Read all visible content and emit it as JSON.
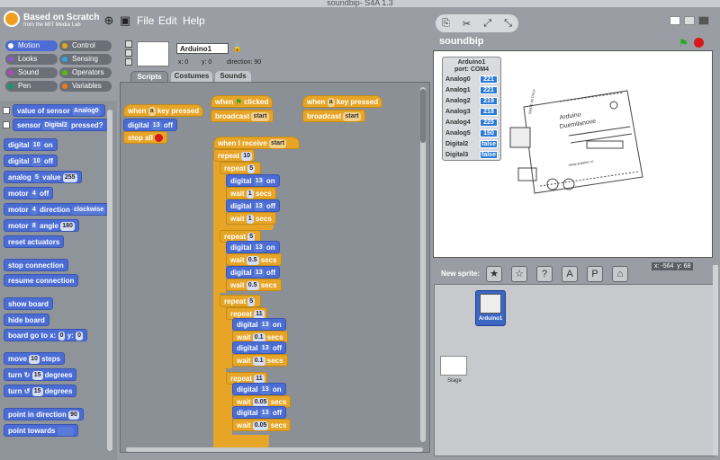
{
  "window": {
    "title": "soundbip- S4A 1.3"
  },
  "header": {
    "logo_line1": "Based on Scratch",
    "logo_line2": "from the MIT Media Lab"
  },
  "menu": {
    "file": "File",
    "edit": "Edit",
    "help": "Help"
  },
  "categories": {
    "motion": "Motion",
    "looks": "Looks",
    "sound": "Sound",
    "pen": "Pen",
    "control": "Control",
    "sensing": "Sensing",
    "operators": "Operators",
    "variables": "Variables",
    "colors": {
      "motion": "#4a6cd4",
      "looks": "#8a55d7",
      "sound": "#bb42c3",
      "pen": "#0e9a6c",
      "control": "#e1a91a",
      "sensing": "#2ca5e2",
      "operators": "#5cb712",
      "variables": "#ee7d16"
    }
  },
  "palette": {
    "value_of_sensor": "value of sensor",
    "sensor_opt": "Analog0",
    "sensor": "sensor",
    "sensor_opt2": "Digital2",
    "pressed": "pressed?",
    "digital": "digital",
    "on": "on",
    "off": "off",
    "pin13": "13",
    "pin10": "10",
    "analog": "analog",
    "analog_pin": "5",
    "value": "value",
    "value_num": "255",
    "motor": "motor",
    "motor_pin": "4",
    "direction": "direction",
    "clockwise": "clockwise",
    "motor_pin2": "8",
    "angle": "angle",
    "angle_num": "180",
    "reset_actuators": "reset actuators",
    "stop_connection": "stop connection",
    "resume_connection": "resume connection",
    "show_board": "show board",
    "hide_board": "hide board",
    "board_go_to": "board go to x:",
    "zero": "0",
    "y": "y:",
    "move": "move",
    "ten": "10",
    "steps": "steps",
    "turn": "turn",
    "fifteen": "15",
    "degrees": "degrees",
    "point_in_direction": "point in direction",
    "ninety": "90",
    "point_towards": "point towards"
  },
  "sprite": {
    "name": "Arduino1",
    "x_label": "x:",
    "x": "0",
    "y_label": "y:",
    "y": "0",
    "dir_label": "direction:",
    "dir": "90"
  },
  "tabs": {
    "scripts": "Scripts",
    "costumes": "Costumes",
    "sounds": "Sounds"
  },
  "scripts": {
    "when": "when",
    "key_pressed": "key pressed",
    "key": "a",
    "clicked": "clicked",
    "stop_all": "stop all",
    "broadcast": "broadcast",
    "start": "start",
    "when_i_receive": "when I receive",
    "repeat": "repeat",
    "r10": "10",
    "r5": "5",
    "r11": "11",
    "wait": "wait",
    "secs": "secs",
    "w1": "1",
    "w05": "0.5",
    "w01": "0.1",
    "w005": "0.05"
  },
  "stage": {
    "title": "soundbip"
  },
  "monitor": {
    "title": "Arduino1",
    "port": "port: COM4",
    "rows": [
      {
        "label": "Analog0",
        "value": "221"
      },
      {
        "label": "Analog1",
        "value": "221"
      },
      {
        "label": "Analog2",
        "value": "219"
      },
      {
        "label": "Analog3",
        "value": "218"
      },
      {
        "label": "Analog4",
        "value": "225"
      },
      {
        "label": "Analog5",
        "value": "150"
      },
      {
        "label": "Digital2",
        "value": "false"
      },
      {
        "label": "Digital3",
        "value": "false"
      }
    ]
  },
  "board_labels": {
    "made_in": "MADE IN ITALY",
    "arduino": "Arduino",
    "duemilanove": "Duemilanove",
    "url": "www.arduino.cc"
  },
  "sprites_panel": {
    "new_sprite": "New sprite:",
    "mouse_x": "x: -564",
    "mouse_y": "y: 68",
    "stage_label": "Stage",
    "sprite1": "Arduino1"
  }
}
